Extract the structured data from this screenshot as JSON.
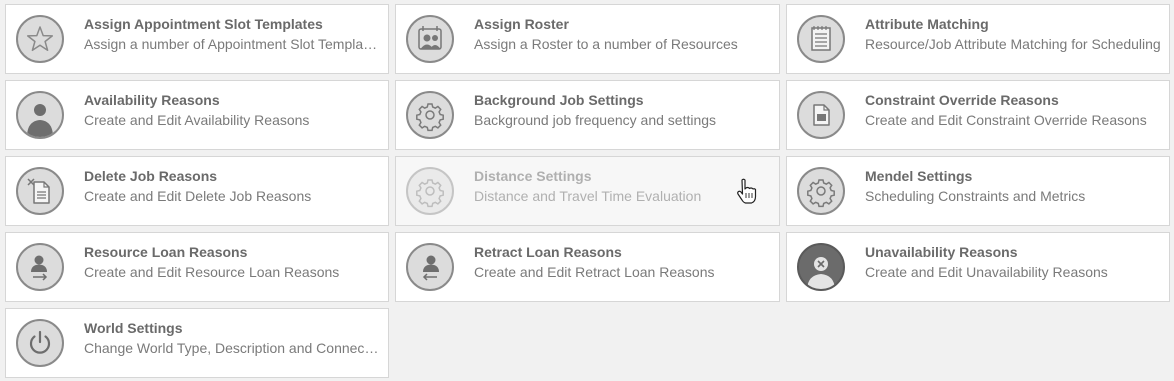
{
  "tiles": [
    {
      "title": "Assign Appointment Slot Templates",
      "description": "Assign a number of Appointment Slot Templates to a number of Resources",
      "icon": "star-icon"
    },
    {
      "title": "Assign Roster",
      "description": "Assign a Roster to a number of Resources",
      "icon": "roster-icon"
    },
    {
      "title": "Attribute Matching",
      "description": "Resource/Job Attribute Matching for Scheduling",
      "icon": "notepad-icon"
    },
    {
      "title": "Availability Reasons",
      "description": "Create and Edit Availability Reasons",
      "icon": "person-icon"
    },
    {
      "title": "Background Job Settings",
      "description": "Background job frequency and settings",
      "icon": "gear-icon"
    },
    {
      "title": "Constraint Override Reasons",
      "description": "Create and Edit Constraint Override Reasons",
      "icon": "document-icon"
    },
    {
      "title": "Delete Job Reasons",
      "description": "Create and Edit Delete Job Reasons",
      "icon": "delete-document-icon"
    },
    {
      "title": "Distance Settings",
      "description": "Distance and Travel Time Evaluation",
      "icon": "gear-icon"
    },
    {
      "title": "Mendel Settings",
      "description": "Scheduling Constraints and Metrics",
      "icon": "gear-icon"
    },
    {
      "title": "Resource Loan Reasons",
      "description": "Create and Edit Resource Loan Reasons",
      "icon": "person-arrow-right-icon"
    },
    {
      "title": "Retract Loan Reasons",
      "description": "Create and Edit Retract Loan Reasons",
      "icon": "person-arrow-left-icon"
    },
    {
      "title": "Unavailability Reasons",
      "description": "Create and Edit Unavailability Reasons",
      "icon": "person-unavailable-icon"
    },
    {
      "title": "World Settings",
      "description": "Change World Type, Description and Connection Settings",
      "icon": "power-icon"
    }
  ],
  "colors": {
    "background": "#f1f1f1",
    "tile": "#ffffff",
    "tile_border": "#d6d6d6",
    "icon_fill": "#dcdcdc",
    "icon_stroke": "#8a8a8a",
    "title_text": "#6a6a6a",
    "description_text": "#7a7a7a"
  },
  "hovered_tile": "Distance Settings"
}
